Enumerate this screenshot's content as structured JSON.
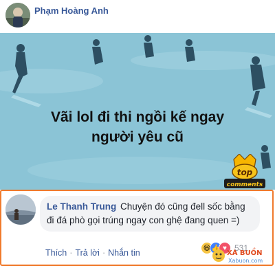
{
  "post": {
    "author": "Phạm Hoàng Anh",
    "headline_line1": "Vãi lol đi thi ngồi kế ngay",
    "headline_line2": "người yêu cũ",
    "badge_top": "top",
    "badge_bottom": "comments"
  },
  "comment": {
    "name": "Le Thanh Trung",
    "text": "Chuyện đó cũng đell sốc bằng đi đá phò gọi trúng ngay con ghệ đang quen =)",
    "reactions_count": "531",
    "actions": [
      "Thích",
      "Trả lời",
      "Nhắn tin"
    ]
  },
  "watermark": {
    "brand": "XÀ BUỒN",
    "domain": "Xabuon.com"
  },
  "colors": {
    "link_blue": "#385898",
    "highlight_border": "#f07a2c",
    "banner_bg": "#8bc4d6"
  }
}
